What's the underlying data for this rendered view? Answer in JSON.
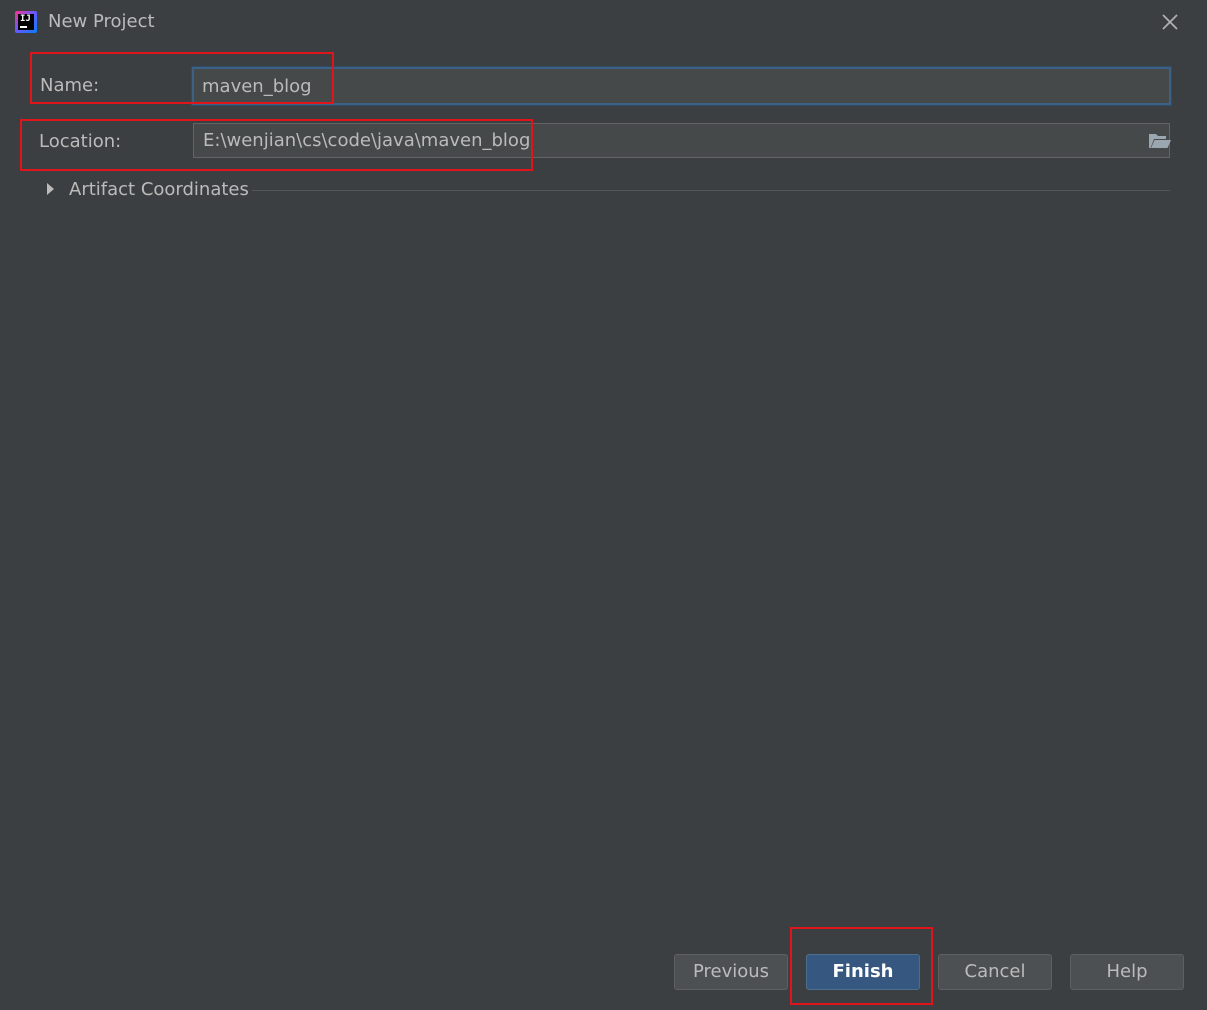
{
  "window": {
    "title": "New Project",
    "app_icon": "intellij-idea-icon",
    "close_icon": "close-icon"
  },
  "form": {
    "name": {
      "label": "Name:",
      "value": "maven_blog"
    },
    "location": {
      "label": "Location:",
      "value": "E:\\wenjian\\cs\\code\\java\\maven_blog",
      "browse_icon": "folder-open-icon"
    }
  },
  "section": {
    "title": "Artifact Coordinates",
    "expanded": false,
    "icon": "chevron-right-icon"
  },
  "buttons": {
    "previous": "Previous",
    "finish": "Finish",
    "cancel": "Cancel",
    "help": "Help"
  },
  "colors": {
    "background": "#3c3f41",
    "text": "#bbbbbb",
    "primary_button": "#365880",
    "focus_border": "#3d6185",
    "annotation": "#e0151b"
  }
}
